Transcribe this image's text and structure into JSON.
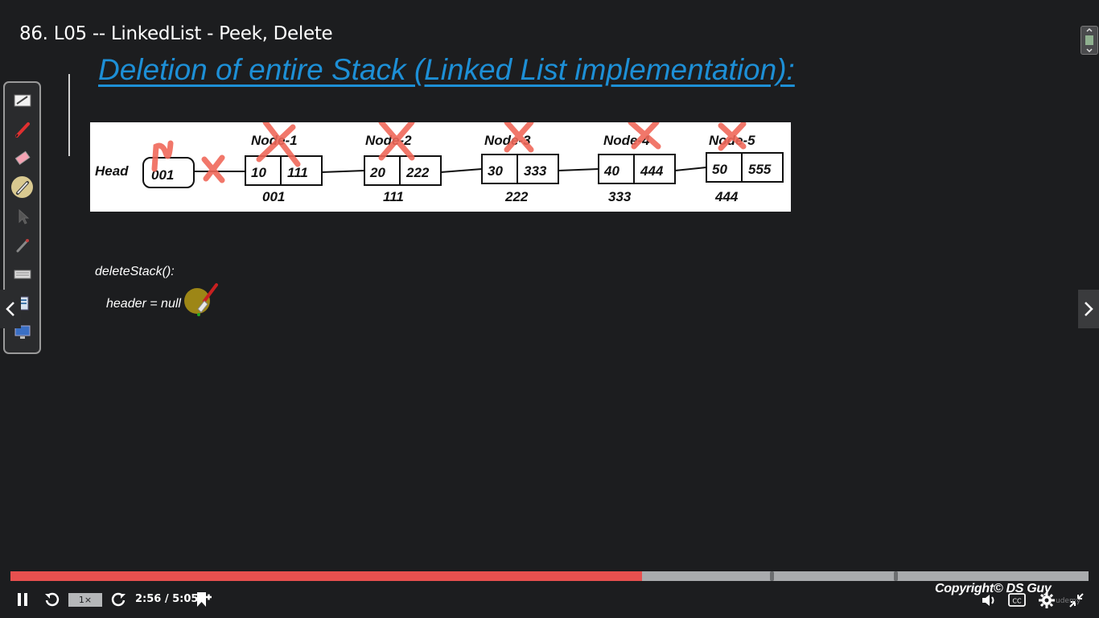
{
  "lecture": {
    "title": "86. L05 -- LinkedList - Peek, Delete"
  },
  "slide": {
    "heading": "Deletion of entire Stack (Linked List implementation):",
    "diagram": {
      "head_label": "Head",
      "head_value": "001",
      "nodes": [
        {
          "label": "Node-1",
          "data": "10",
          "next": "111",
          "address": "001"
        },
        {
          "label": "Node-2",
          "data": "20",
          "next": "222",
          "address": "111"
        },
        {
          "label": "Node-3",
          "data": "30",
          "next": "333",
          "address": "222"
        },
        {
          "label": "Node-4",
          "data": "40",
          "next": "444",
          "address": "333"
        },
        {
          "label": "Node-5",
          "data": "50",
          "next": "555",
          "address": "444"
        }
      ],
      "annotation_color": "#f0685a"
    },
    "code": {
      "line1": "deleteStack():",
      "line2": "header = null"
    }
  },
  "toolbar": {
    "tools": [
      "whiteboard-icon",
      "pen-icon",
      "eraser-icon",
      "highlighter-icon",
      "pointer-icon",
      "brush-icon",
      "keyboard-icon",
      "screen-capture-icon",
      "display-icon"
    ]
  },
  "player": {
    "progress": 0.586,
    "markers": [
      0.706,
      0.821
    ],
    "speed": "1×",
    "time": "2:56 / 5:05",
    "copyright": "Copyright© DS Guy",
    "watermark": "udemy",
    "colors": {
      "progress": "#e8504f",
      "track": "#a9abad",
      "heading": "#1d8fd6"
    }
  }
}
